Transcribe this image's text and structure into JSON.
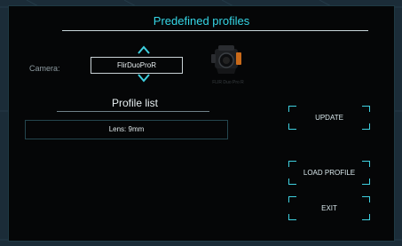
{
  "dialog": {
    "title": "Predefined profiles"
  },
  "camera": {
    "label": "Camera:",
    "selected": "FlirDuoProR",
    "caption": "FLIR Duo Pro R"
  },
  "profiles": {
    "heading": "Profile list",
    "items": [
      "Lens: 9mm"
    ]
  },
  "buttons": {
    "update": "UPDATE",
    "load": "LOAD PROFILE",
    "exit": "EXIT"
  },
  "colors": {
    "accent": "#35d6e6",
    "background": "#1b2c38",
    "panel": "#050607"
  },
  "icons": {
    "up": "chevron-up-icon",
    "down": "chevron-down-icon",
    "camera": "camera-icon"
  }
}
